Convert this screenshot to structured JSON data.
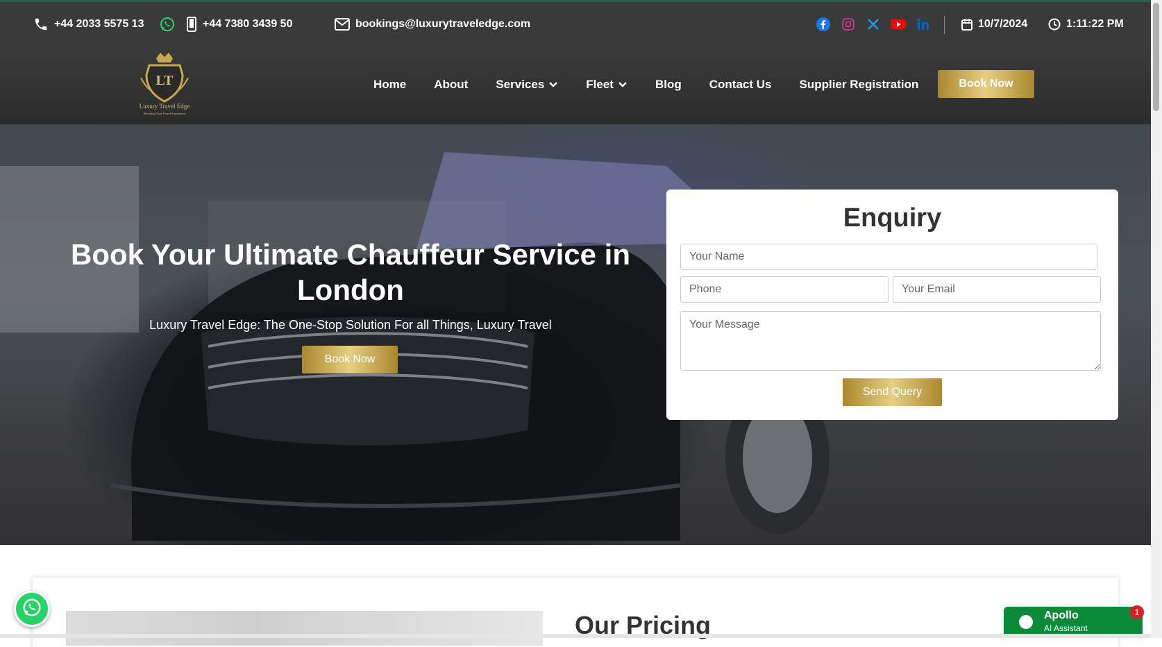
{
  "topbar": {
    "phone1": "+44 2033 5575 13",
    "phone2": "+44 7380 3439 50",
    "email": "bookings@luxurytraveledge.com",
    "date": "10/7/2024",
    "time": "1:11:22 PM",
    "social_icons": [
      "facebook-icon",
      "instagram-icon",
      "x-icon",
      "youtube-icon",
      "linkedin-icon"
    ]
  },
  "logo": {
    "monogram": "LT",
    "name": "Luxury Travel Edge",
    "tagline": "Elevating Your Travel Experience"
  },
  "nav": {
    "items": [
      "Home",
      "About",
      "Services",
      "Fleet",
      "Blog",
      "Contact Us",
      "Supplier Registration"
    ],
    "book_label": "Book Now"
  },
  "hero": {
    "title": "Book Your Ultimate Chauffeur Service in London",
    "subtitle": "Luxury Travel Edge: The One-Stop Solution For all Things, Luxury Travel",
    "book_label": "Book Now"
  },
  "enquiry": {
    "title": "Enquiry",
    "name_placeholder": "Your Name",
    "phone_placeholder": "Phone",
    "email_placeholder": "Your Email",
    "message_placeholder": "Your Message",
    "send_label": "Send Query"
  },
  "pricing": {
    "title": "Our Pricing"
  },
  "apollo": {
    "name": "Apollo",
    "subtitle": "AI Assistant",
    "badge": "1"
  },
  "colors": {
    "gold": "#c9a84c",
    "topbar": "#3a3a3a",
    "whatsapp": "#25d366",
    "apollo": "#0b8a3a"
  }
}
